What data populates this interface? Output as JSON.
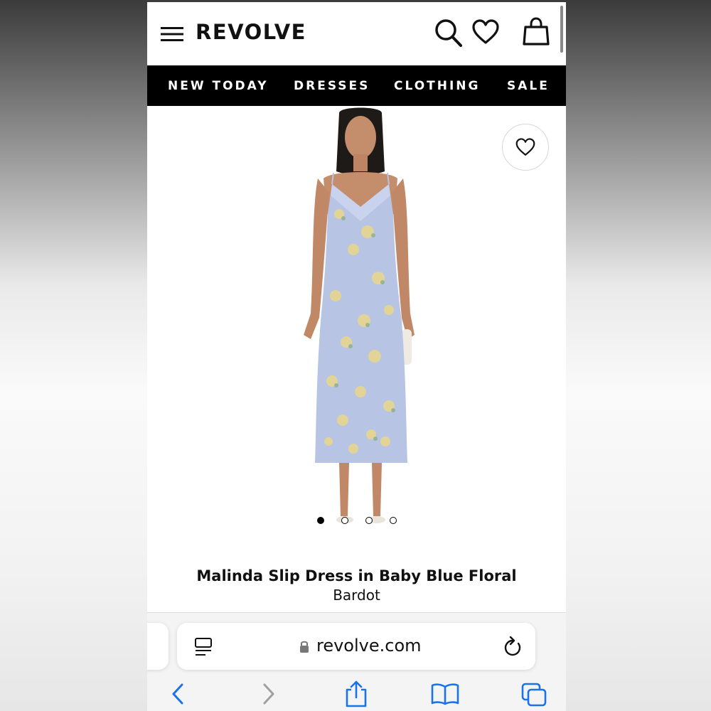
{
  "header": {
    "brand": "REVOLVE",
    "icons": [
      "menu-icon",
      "search-icon",
      "heart-icon",
      "bag-icon"
    ]
  },
  "nav": {
    "items": [
      "NEW TODAY",
      "DRESSES",
      "CLOTHING",
      "SALE"
    ]
  },
  "product": {
    "title": "Malinda Slip Dress in Baby Blue Floral",
    "brand": "Bardot",
    "image_dots": {
      "count": 4,
      "active": 1
    },
    "dress_color": "#b7c4e4"
  },
  "browser": {
    "url": "revolve.com",
    "toolbar_icons": [
      "back-icon",
      "forward-icon",
      "share-icon",
      "bookmarks-icon",
      "tabs-icon"
    ],
    "accent": "#1a73e8"
  }
}
